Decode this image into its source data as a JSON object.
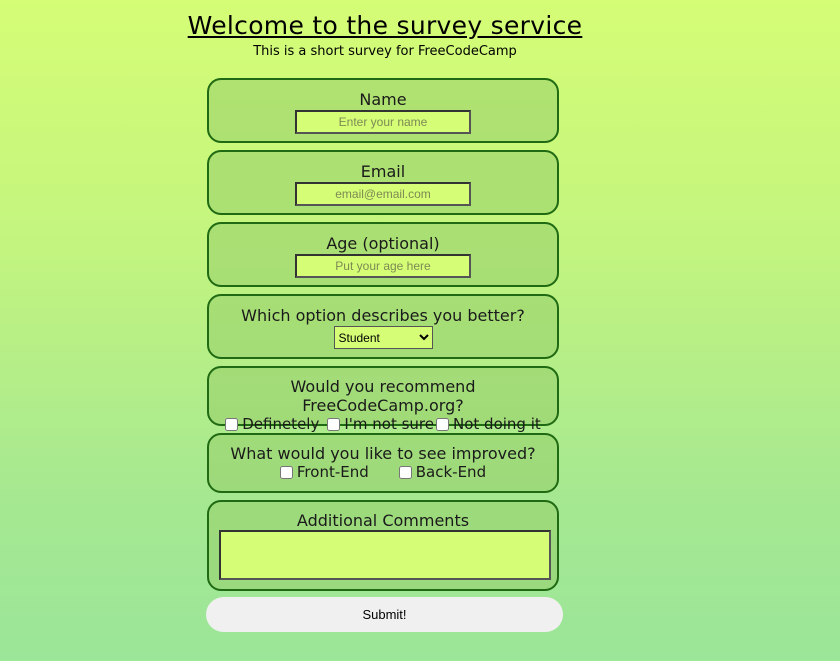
{
  "header": {
    "title": "Welcome to the survey service",
    "subtitle": "This is a short survey for FreeCodeCamp"
  },
  "form": {
    "name": {
      "label": "Name",
      "placeholder": "Enter your name"
    },
    "email": {
      "label": "Email",
      "placeholder": "email@email.com"
    },
    "age": {
      "label": "Age (optional)",
      "placeholder": "Put your age here"
    },
    "role": {
      "label": "Which option describes you better?",
      "selected": "Student"
    },
    "recommend": {
      "label": "Would you recommend FreeCodeCamp.org?",
      "options": [
        "Definetely",
        "I'm not sure",
        "Not doing it"
      ]
    },
    "improve": {
      "label": "What would you like to see improved?",
      "options": [
        "Front-End",
        "Back-End"
      ]
    },
    "comments": {
      "label": "Additional Comments"
    },
    "submit_label": "Submit!"
  }
}
